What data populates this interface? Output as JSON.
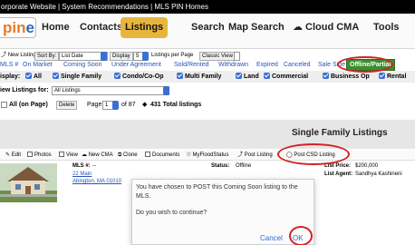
{
  "titlebar": {
    "text": "orporate Website | System Recommendations | MLS PIN Homes"
  },
  "nav": {
    "logo_part1": "pin",
    "logo_part2": "ergy",
    "items": [
      "Home",
      "Contacts",
      "Listings",
      "Search",
      "Map Search",
      "Cloud CMA",
      "Tools"
    ],
    "active": "Listings",
    "active_color": "#e8b53c"
  },
  "toolbar": {
    "new_listing": "New Listing",
    "sort_by_label": "Sort By:",
    "sort_by_value": "List Date",
    "display_label": "Display",
    "display_value": "5",
    "per_page_label": "Listings per Page",
    "classic_view": "Classic View"
  },
  "tabs": {
    "items": [
      "MLS #",
      "On Market",
      "Coming Soon",
      "Under Agreement",
      "Sold/Rented",
      "Withdrawn",
      "Expired",
      "Canceled",
      "Sale Side",
      "Offline/Partial"
    ],
    "active": "Offline/Partial",
    "active_color": "#3a8f2c"
  },
  "display_filters": {
    "label": "isplay:",
    "items": [
      "All",
      "Single Family",
      "Condo/Co-Op",
      "Multi Family",
      "Land",
      "Commercial",
      "Business Op",
      "Rental"
    ]
  },
  "view_for": {
    "label": "iew Listings for:",
    "value": "All Listings"
  },
  "paging": {
    "all_on_page": "All (on Page)",
    "delete_label": "Delete",
    "page_label": "Page",
    "page_value": "1",
    "of_pages": "of 87",
    "total": "431 Total listings"
  },
  "section_heading": "Single Family Listings",
  "actions": {
    "items": [
      "Edit",
      "Photos",
      "View",
      "New CMA",
      "Clone",
      "Documents",
      "MyFloodStatus",
      "Post Listing",
      "Post CSD Listing"
    ]
  },
  "listing": {
    "mls_label": "MLS #:",
    "mls_value": "--",
    "address_line1": "22 Main",
    "address_line2": "Abington, MA 01010",
    "status_label": "Status:",
    "status_value": "Offline",
    "price_label": "List Price:",
    "price_value": "$200,000",
    "agent_label": "List Agent:",
    "agent_value": "Sandhya Kashineni"
  },
  "dialog": {
    "message": "You have chosen to POST this Coming Soon listing to the MLS.",
    "question": "Do you wish to continue?",
    "cancel_label": "Cancel",
    "ok_label": "OK"
  },
  "highlight_color": "#d42222"
}
